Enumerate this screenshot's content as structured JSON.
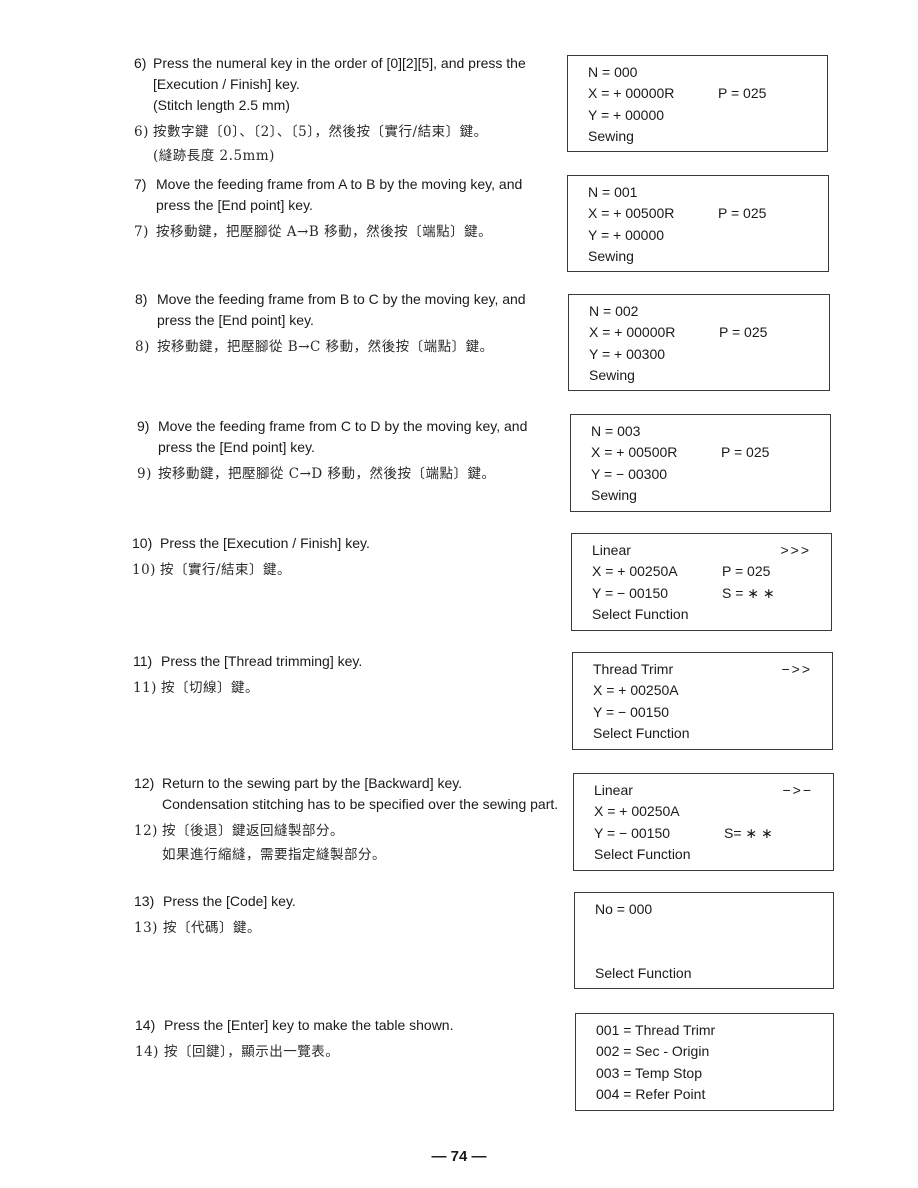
{
  "steps": [
    {
      "number": "6)",
      "english": [
        "Press the numeral key in the order of [0][2][5], and press the",
        "[Execution / Finish] key.",
        "(Stitch length 2.5 mm)"
      ],
      "chinese_number": "6)",
      "chinese": [
        "按數字鍵〔0〕、〔2〕、〔5〕，然後按〔實行/結束〕鍵。",
        "(縫跡長度 2.5mm)"
      ],
      "panel": {
        "rows": [
          {
            "left": "N = 000",
            "mid": "",
            "right": ""
          },
          {
            "left": "X = + 00000R",
            "mid": "P = 025",
            "right": ""
          },
          {
            "left": "Y = + 00000",
            "mid": "",
            "right": ""
          },
          {
            "left": "Sewing",
            "mid": "",
            "right": ""
          }
        ]
      }
    },
    {
      "number": "7)",
      "english": [
        "Move the feeding frame from A to B by the moving key, and",
        "press the [End point] key."
      ],
      "chinese_number": "7)",
      "chinese": [
        "按移動鍵，把壓腳從 A→B 移動，然後按〔端點〕鍵。"
      ],
      "panel": {
        "rows": [
          {
            "left": "N = 001",
            "mid": "",
            "right": ""
          },
          {
            "left": "X = + 00500R",
            "mid": "P = 025",
            "right": ""
          },
          {
            "left": "Y = + 00000",
            "mid": "",
            "right": ""
          },
          {
            "left": "Sewing",
            "mid": "",
            "right": ""
          }
        ]
      }
    },
    {
      "number": "8)",
      "english": [
        "Move the feeding frame from B to C by the moving key, and",
        "press the [End point] key."
      ],
      "chinese_number": "8)",
      "chinese": [
        "按移動鍵，把壓腳從 B→C 移動，然後按〔端點〕鍵。"
      ],
      "panel": {
        "rows": [
          {
            "left": "N = 002",
            "mid": "",
            "right": ""
          },
          {
            "left": "X = + 00000R",
            "mid": "P = 025",
            "right": ""
          },
          {
            "left": "Y = + 00300",
            "mid": "",
            "right": ""
          },
          {
            "left": "Sewing",
            "mid": "",
            "right": ""
          }
        ]
      }
    },
    {
      "number": "9)",
      "english": [
        "Move the feeding frame from C to D by the moving key, and",
        "press the [End point] key."
      ],
      "chinese_number": "9)",
      "chinese": [
        "按移動鍵，把壓腳從 C→D 移動，然後按〔端點〕鍵。"
      ],
      "panel": {
        "rows": [
          {
            "left": "N = 003",
            "mid": "",
            "right": ""
          },
          {
            "left": "X = + 00500R",
            "mid": "P = 025",
            "right": ""
          },
          {
            "left": "Y = − 00300",
            "mid": "",
            "right": ""
          },
          {
            "left": "Sewing",
            "mid": "",
            "right": ""
          }
        ]
      }
    },
    {
      "number": "10)",
      "english": [
        "Press the [Execution / Finish] key."
      ],
      "chinese_number": "10)",
      "chinese": [
        "按〔實行/結束〕鍵。"
      ],
      "panel": {
        "rows": [
          {
            "left": "Linear",
            "mid": "",
            "right": ">>>"
          },
          {
            "left": "X = + 00250A",
            "mid": "P = 025",
            "right": ""
          },
          {
            "left": "Y = − 00150",
            "mid": "S = ∗ ∗",
            "right": ""
          },
          {
            "left": "Select Function",
            "mid": "",
            "right": ""
          }
        ]
      }
    },
    {
      "number": "11)",
      "english": [
        "Press the [Thread trimming] key."
      ],
      "chinese_number": "11)",
      "chinese": [
        "按〔切線〕鍵。"
      ],
      "panel": {
        "rows": [
          {
            "left": "Thread Trimr",
            "mid": "",
            "right": "−>>"
          },
          {
            "left": "X = + 00250A",
            "mid": "",
            "right": ""
          },
          {
            "left": "Y = − 00150",
            "mid": "",
            "right": ""
          },
          {
            "left": "Select Function",
            "mid": "",
            "right": ""
          }
        ]
      }
    },
    {
      "number": "12)",
      "english": [
        "Return to the sewing part by the [Backward] key.",
        "Condensation stitching has to be specified over the sewing part."
      ],
      "chinese_number": "12)",
      "chinese": [
        "按〔後退〕鍵返回縫製部分。",
        "如果進行縮縫，需要指定縫製部分。"
      ],
      "panel": {
        "rows": [
          {
            "left": "Linear",
            "mid": "",
            "right": "−>−"
          },
          {
            "left": "X = + 00250A",
            "mid": "",
            "right": ""
          },
          {
            "left": "Y = − 00150",
            "mid": "S= ∗ ∗",
            "right": ""
          },
          {
            "left": "Select Function",
            "mid": "",
            "right": ""
          }
        ]
      }
    },
    {
      "number": "13)",
      "english": [
        "Press the [Code] key."
      ],
      "chinese_number": "13)",
      "chinese": [
        "按〔代碼〕鍵。"
      ],
      "panel": {
        "rows": [
          {
            "left": "No = 000",
            "mid": "",
            "right": ""
          },
          {
            "left": "",
            "mid": "",
            "right": ""
          },
          {
            "left": "",
            "mid": "",
            "right": ""
          },
          {
            "left": "Select Function",
            "mid": "",
            "right": ""
          }
        ]
      }
    },
    {
      "number": "14)",
      "english": [
        "Press the [Enter] key to make the table shown."
      ],
      "chinese_number": "14)",
      "chinese": [
        "按〔回鍵〕，顯示出一覽表。"
      ],
      "panel": {
        "rows": [
          {
            "left": "001 = Thread Trimr",
            "mid": "",
            "right": ""
          },
          {
            "left": "002 = Sec - Origin",
            "mid": "",
            "right": ""
          },
          {
            "left": "003 = Temp Stop",
            "mid": "",
            "right": ""
          },
          {
            "left": "004 = Refer Point",
            "mid": "",
            "right": ""
          }
        ]
      }
    }
  ],
  "footer": {
    "page_number": "— 74 —"
  }
}
